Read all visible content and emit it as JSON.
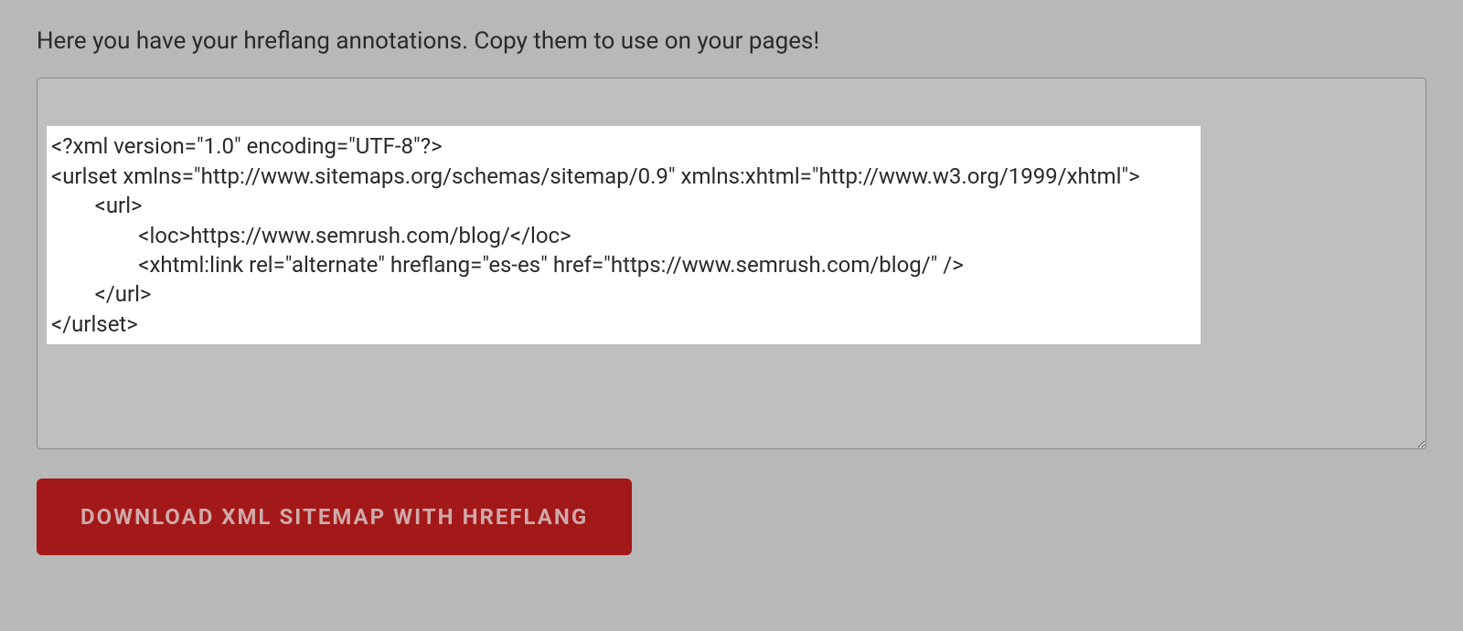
{
  "intro": "Here you have your hreflang annotations. Copy them to use on your pages!",
  "code": {
    "line1": "<?xml version=\"1.0\" encoding=\"UTF-8\"?>",
    "line2": "<urlset xmlns=\"http://www.sitemaps.org/schemas/sitemap/0.9\" xmlns:xhtml=\"http://www.w3.org/1999/xhtml\">",
    "line3": "        <url>",
    "line4": "                <loc>https://www.semrush.com/blog/</loc>",
    "line5": "                <xhtml:link rel=\"alternate\" hreflang=\"es-es\" href=\"https://www.semrush.com/blog/\" />",
    "line6": "        </url>",
    "line7": "</urlset>"
  },
  "button_label": "DOWNLOAD XML SITEMAP WITH HREFLANG"
}
